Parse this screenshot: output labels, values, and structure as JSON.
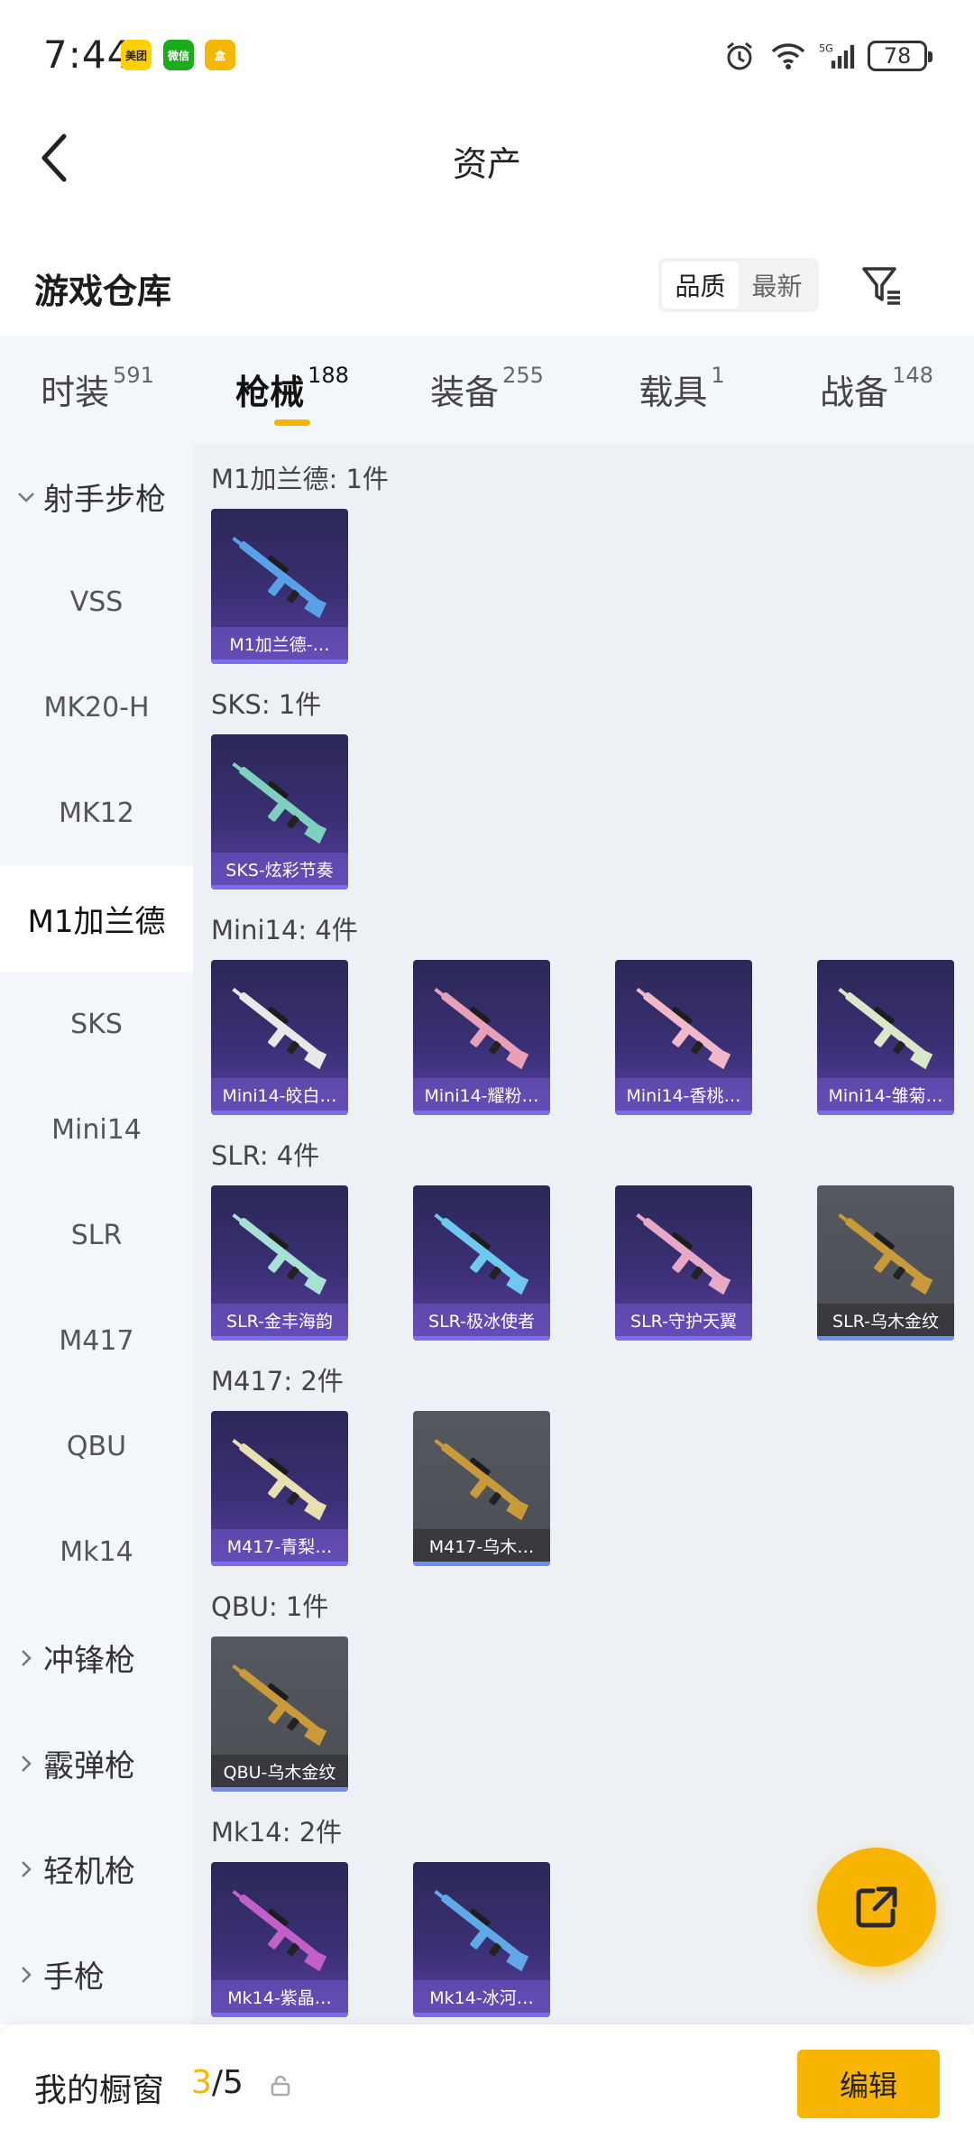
{
  "status_bar": {
    "time": "7:44",
    "apps": [
      "美团",
      "微信",
      "盒"
    ],
    "network": "5G",
    "battery": "78"
  },
  "header": {
    "title": "资产"
  },
  "warehouse": {
    "title": "游戏仓库",
    "sort_options": [
      {
        "label": "品质",
        "active": true
      },
      {
        "label": "最新",
        "active": false
      }
    ]
  },
  "tabs": [
    {
      "label": "时装",
      "count": "591"
    },
    {
      "label": "枪械",
      "count": "188",
      "active": true
    },
    {
      "label": "装备",
      "count": "255"
    },
    {
      "label": "载具",
      "count": "1"
    },
    {
      "label": "战备",
      "count": "148"
    }
  ],
  "sidebar": {
    "items": [
      {
        "label": "射手步枪",
        "type": "category",
        "expanded": true
      },
      {
        "label": "VSS"
      },
      {
        "label": "MK20-H"
      },
      {
        "label": "MK12"
      },
      {
        "label": "M1加兰德",
        "active": true
      },
      {
        "label": "SKS"
      },
      {
        "label": "Mini14"
      },
      {
        "label": "SLR"
      },
      {
        "label": "M417"
      },
      {
        "label": "QBU"
      },
      {
        "label": "Mk14"
      },
      {
        "label": "冲锋枪",
        "type": "category"
      },
      {
        "label": "霰弹枪",
        "type": "category"
      },
      {
        "label": "轻机枪",
        "type": "category"
      },
      {
        "label": "手枪",
        "type": "category"
      }
    ]
  },
  "groups": [
    {
      "title": "M1加兰德: 1件",
      "items": [
        {
          "label": "M1加兰德-…",
          "style": "purple",
          "gun": "#5aa0e8"
        }
      ]
    },
    {
      "title": "SKS: 1件",
      "items": [
        {
          "label": "SKS-炫彩节奏",
          "style": "purple",
          "gun": "#7fd0c0"
        }
      ]
    },
    {
      "title": "Mini14: 4件",
      "items": [
        {
          "label": "Mini14-皎白…",
          "style": "purple",
          "gun": "#e8e8e8"
        },
        {
          "label": "Mini14-耀粉…",
          "style": "purple",
          "gun": "#e6a0b8"
        },
        {
          "label": "Mini14-香桃…",
          "style": "purple",
          "gun": "#f0b8c8"
        },
        {
          "label": "Mini14-雏菊…",
          "style": "purple",
          "gun": "#d8e8c8"
        }
      ]
    },
    {
      "title": "SLR: 4件",
      "items": [
        {
          "label": "SLR-金丰海韵",
          "style": "purple",
          "gun": "#a8e0d8"
        },
        {
          "label": "SLR-极冰使者",
          "style": "purple",
          "gun": "#6fc8f0"
        },
        {
          "label": "SLR-守护天翼",
          "style": "purple",
          "gun": "#e8a8c8"
        },
        {
          "label": "SLR-乌木金纹",
          "style": "gray",
          "gun": "#c89a3a"
        }
      ]
    },
    {
      "title": "M417: 2件",
      "items": [
        {
          "label": "M417-青梨…",
          "style": "purple",
          "gun": "#e8e0b0"
        },
        {
          "label": "M417-乌木…",
          "style": "gray",
          "gun": "#c89a3a"
        }
      ]
    },
    {
      "title": "QBU: 1件",
      "items": [
        {
          "label": "QBU-乌木金纹",
          "style": "gray",
          "gun": "#c89a3a"
        }
      ]
    },
    {
      "title": "Mk14: 2件",
      "items": [
        {
          "label": "Mk14-紫晶…",
          "style": "purple",
          "gun": "#c060c8"
        },
        {
          "label": "Mk14-冰河…",
          "style": "purple",
          "gun": "#60a8e8"
        }
      ]
    }
  ],
  "bottom": {
    "showcase_label": "我的橱窗",
    "current": "3",
    "total": "/5",
    "edit_label": "编辑"
  },
  "colors": {
    "accent": "#f8b500",
    "rare_purple": "#3a2f74",
    "legend_gray": "#4b4e54"
  }
}
